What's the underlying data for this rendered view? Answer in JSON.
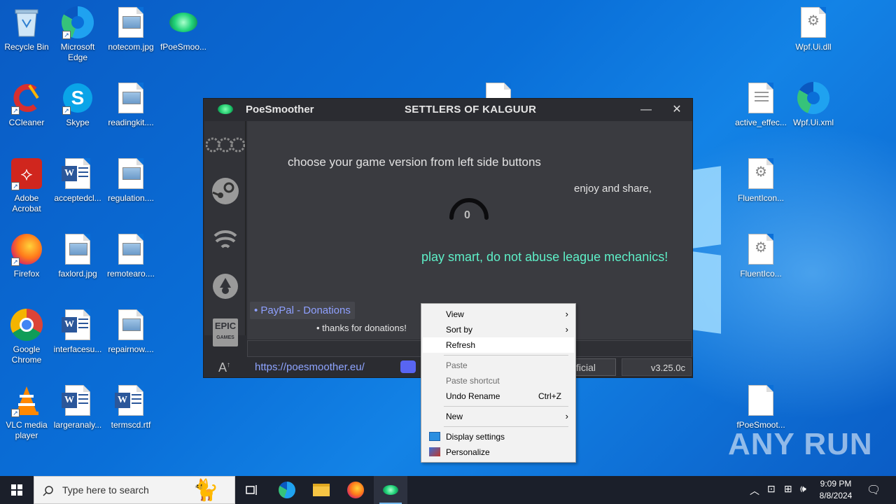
{
  "desktop": {
    "icons_col1": [
      {
        "label": "Recycle Bin"
      },
      {
        "label": "CCleaner"
      },
      {
        "label": "Adobe Acrobat"
      },
      {
        "label": "Firefox"
      },
      {
        "label": "Google Chrome"
      },
      {
        "label": "VLC media player"
      }
    ],
    "icons_col2": [
      {
        "label": "Microsoft Edge"
      },
      {
        "label": "Skype"
      },
      {
        "label": "acceptedcl..."
      },
      {
        "label": "faxlord.jpg"
      },
      {
        "label": "interfacesu..."
      },
      {
        "label": "largeranaly..."
      }
    ],
    "icons_col3": [
      {
        "label": "notecom.jpg"
      },
      {
        "label": "readingkit...."
      },
      {
        "label": "regulation...."
      },
      {
        "label": "remotearo...."
      },
      {
        "label": "repairnow...."
      },
      {
        "label": "termscd.rtf"
      }
    ],
    "icon_fpoe": {
      "label": "fPoeSmoo..."
    },
    "icons_right": [
      {
        "label": "Wpf.Ui.dll"
      },
      {
        "label": "active_effec..."
      },
      {
        "label": "Wpf.Ui.xml"
      },
      {
        "label": "FluentIcon..."
      },
      {
        "label": "FluentIco..."
      },
      {
        "label": "fPoeSmoot..."
      }
    ],
    "watermark": "ANY RUN"
  },
  "app": {
    "name": "PoeSmoother",
    "subtitle": "SETTLERS OF KALGUUR",
    "minimize": "—",
    "close": "✕",
    "instruction": "choose your game version from left side buttons",
    "enjoy": "enjoy and share,",
    "counter": "0",
    "warning": "play smart, do not abuse league mechanics!",
    "paypal": "• PayPal - Donations",
    "thanks": "• thanks for donations!",
    "url": "https://poesmoother.eu/",
    "official": "ficial",
    "version": "v3.25.0c",
    "sidebar": [
      "ggg-icon",
      "steam-icon",
      "garena-icon",
      "tencent-icon",
      "epic-icon"
    ],
    "colors": {
      "warning": "#5ef0c8",
      "link": "#8ea4ff"
    }
  },
  "context_menu": {
    "items": [
      {
        "label": "View",
        "submenu": true
      },
      {
        "label": "Sort by",
        "submenu": true
      },
      {
        "label": "Refresh"
      },
      {
        "label": "Paste",
        "disabled": true
      },
      {
        "label": "Paste shortcut",
        "disabled": true
      },
      {
        "label": "Undo Rename",
        "shortcut": "Ctrl+Z"
      },
      {
        "label": "New",
        "submenu": true
      },
      {
        "label": "Display settings"
      },
      {
        "label": "Personalize"
      }
    ]
  },
  "taskbar": {
    "search_placeholder": "Type here to search",
    "time": "9:09 PM",
    "date": "8/8/2024"
  }
}
